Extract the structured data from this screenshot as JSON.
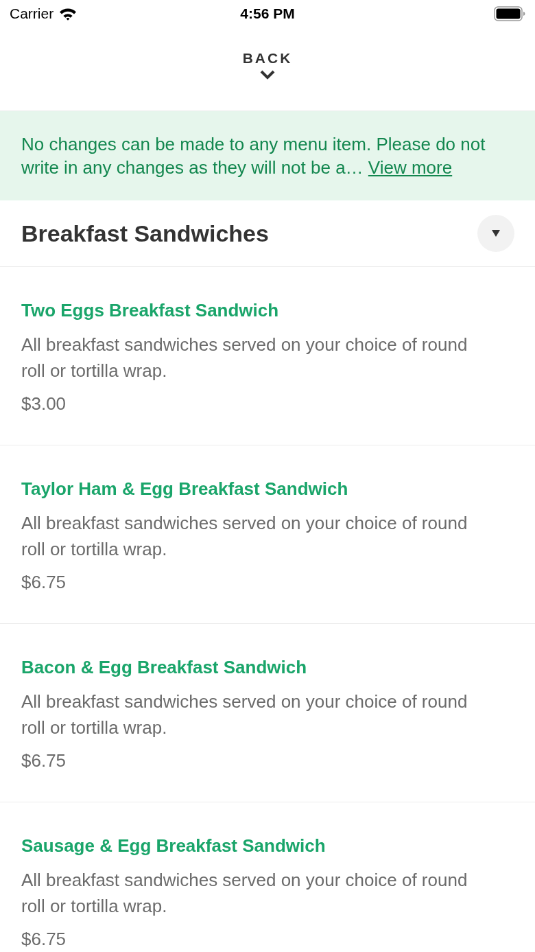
{
  "status_bar": {
    "carrier": "Carrier",
    "time": "4:56 PM"
  },
  "nav": {
    "back_label": "BACK"
  },
  "notice": {
    "text": "No changes can be made to any menu item. Please do not write in any changes as they will not be a…",
    "link": "View more"
  },
  "section": {
    "title": "Breakfast Sandwiches"
  },
  "items": [
    {
      "name": "Two Eggs Breakfast Sandwich",
      "description": "All breakfast sandwiches served on your choice of round roll or tortilla wrap.",
      "price": "$3.00"
    },
    {
      "name": "Taylor Ham & Egg Breakfast Sandwich",
      "description": "All breakfast sandwiches served on your choice of round roll or tortilla wrap.",
      "price": "$6.75"
    },
    {
      "name": "Bacon & Egg Breakfast Sandwich",
      "description": "All breakfast sandwiches served on your choice of round roll or tortilla wrap.",
      "price": "$6.75"
    },
    {
      "name": "Sausage & Egg Breakfast Sandwich",
      "description": "All breakfast sandwiches served on your choice of round roll or tortilla wrap.",
      "price": "$6.75"
    }
  ]
}
